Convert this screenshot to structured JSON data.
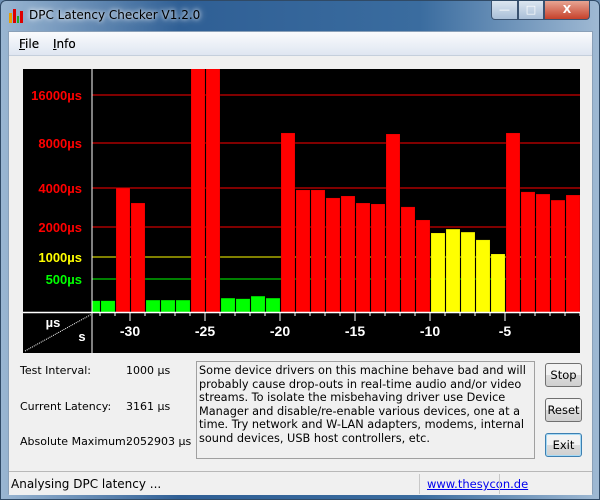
{
  "window": {
    "title": "DPC Latency Checker V1.2.0",
    "controls": {
      "minimize": "—",
      "maximize": "□",
      "close": "X"
    }
  },
  "menu": [
    {
      "label": "File",
      "accel": "F",
      "rest": "ile"
    },
    {
      "label": "Info",
      "accel": "I",
      "rest": "nfo"
    }
  ],
  "chart_data": {
    "type": "bar",
    "xlabel": "s",
    "ylabel": "µs",
    "y_ticks": [
      {
        "value": 16000,
        "label": "16000µs",
        "color": "#ff0000"
      },
      {
        "value": 8000,
        "label": "8000µs",
        "color": "#ff0000"
      },
      {
        "value": 4000,
        "label": "4000µs",
        "color": "#ff0000"
      },
      {
        "value": 2000,
        "label": "2000µs",
        "color": "#ff0000"
      },
      {
        "value": 1000,
        "label": "1000µs",
        "color": "#ffff00"
      },
      {
        "value": 500,
        "label": "500µs",
        "color": "#00ff00"
      }
    ],
    "x_ticks": [
      -30,
      -25,
      -20,
      -15,
      -10,
      -5
    ],
    "x_tick_labels": [
      "-30",
      "-25",
      "-20",
      "-15",
      "-10",
      "-5"
    ],
    "xlim": [
      -32.5,
      0
    ],
    "ylim": [
      0,
      16000
    ],
    "x": [
      -32,
      -31,
      -30,
      -29,
      -28,
      -27,
      -26,
      -25,
      -24,
      -23,
      -22,
      -21,
      -20,
      -19,
      -18,
      -17,
      -16,
      -15,
      -14,
      -13,
      -12,
      -11,
      -10,
      -9,
      -8,
      -7,
      -6,
      -5,
      -4,
      -3,
      -2,
      -1,
      0
    ],
    "values": [
      170,
      170,
      4000,
      3230,
      180,
      180,
      180,
      2052903,
      30000,
      210,
      200,
      240,
      210,
      9670,
      3900,
      3900,
      3490,
      3590,
      3230,
      3180,
      9500,
      3030,
      2360,
      1800,
      1930,
      1830,
      1570,
      1100,
      9670,
      3800,
      3690,
      3380,
      3640
    ],
    "colors": {
      "ok": "#00ff00",
      "warn": "#ffff00",
      "bad": "#ff0000",
      "background": "#000000"
    }
  },
  "stats": {
    "test_interval_label": "Test Interval:",
    "test_interval_value": "1000 µs",
    "current_latency_label": "Current Latency:",
    "current_latency_value": "3161 µs",
    "absolute_max_label": "Absolute Maximum:",
    "absolute_max_value": "2052903 µs"
  },
  "info_text": "Some device drivers on this machine behave bad and will probably cause drop-outs in real-time audio and/or video streams. To isolate the misbehaving driver use Device Manager and disable/re-enable various devices, one at a time. Try network and W-LAN adapters, modems, internal sound devices, USB host controllers, etc.",
  "buttons": {
    "stop": "Stop",
    "reset": "Reset",
    "exit": "Exit"
  },
  "status": {
    "text": "Analysing DPC latency ...",
    "link": "www.thesycon.de"
  }
}
